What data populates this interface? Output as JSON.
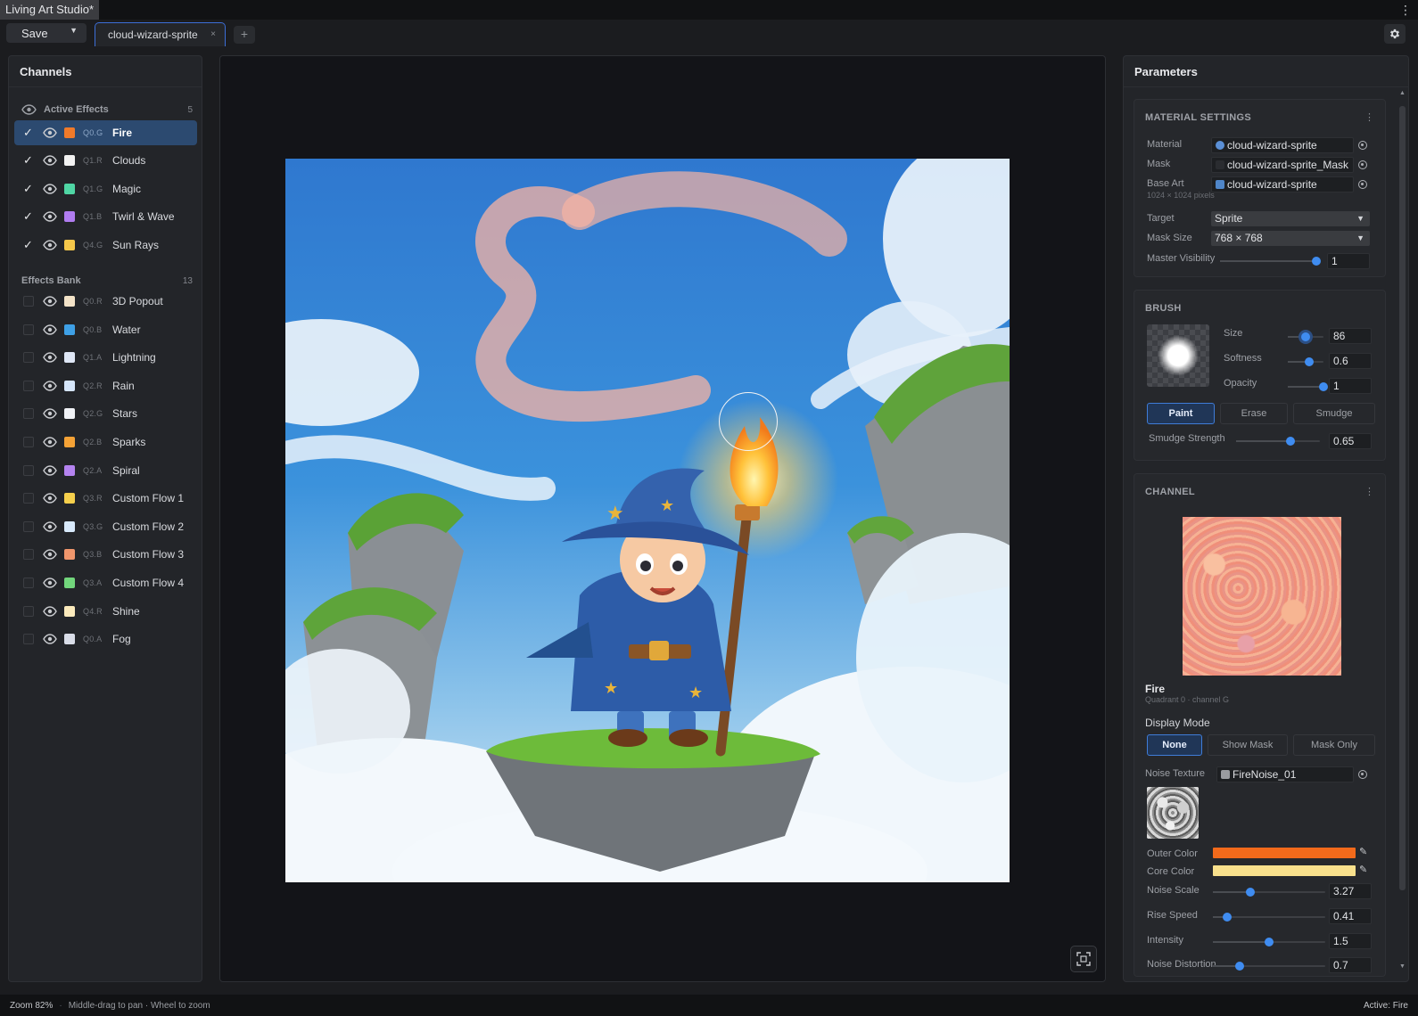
{
  "app": {
    "title": "Living Art Studio*"
  },
  "toolbar": {
    "save_label": "Save",
    "tab_label": "cloud-wizard-sprite",
    "new_tab_label": "+",
    "close_label": "×"
  },
  "channels": {
    "title": "Channels",
    "active_group": {
      "label": "Active Effects",
      "count": "5"
    },
    "bank_group": {
      "label": "Effects Bank",
      "count": "13"
    },
    "active": [
      {
        "code": "Q0.G",
        "name": "Fire",
        "color": "#f07a2a",
        "checked": true,
        "selected": true
      },
      {
        "code": "Q1.R",
        "name": "Clouds",
        "color": "#f2f2f2",
        "checked": true
      },
      {
        "code": "Q1.G",
        "name": "Magic",
        "color": "#4fd6a4",
        "checked": true
      },
      {
        "code": "Q1.B",
        "name": "Twirl & Wave",
        "color": "#b07cf0",
        "checked": true
      },
      {
        "code": "Q4.G",
        "name": "Sun Rays",
        "color": "#f6c84a",
        "checked": true
      }
    ],
    "bank": [
      {
        "code": "Q0.R",
        "name": "3D Popout",
        "color": "#f3e3c8"
      },
      {
        "code": "Q0.B",
        "name": "Water",
        "color": "#3ea0e6"
      },
      {
        "code": "Q1.A",
        "name": "Lightning",
        "color": "#dfe7f6"
      },
      {
        "code": "Q2.R",
        "name": "Rain",
        "color": "#d6e6fb"
      },
      {
        "code": "Q2.G",
        "name": "Stars",
        "color": "#f0f2f6"
      },
      {
        "code": "Q2.B",
        "name": "Sparks",
        "color": "#f5a236"
      },
      {
        "code": "Q2.A",
        "name": "Spiral",
        "color": "#b483f0"
      },
      {
        "code": "Q3.R",
        "name": "Custom Flow 1",
        "color": "#f6d04c"
      },
      {
        "code": "Q3.G",
        "name": "Custom Flow 2",
        "color": "#d8e9fb"
      },
      {
        "code": "Q3.B",
        "name": "Custom Flow 3",
        "color": "#f0966c"
      },
      {
        "code": "Q3.A",
        "name": "Custom Flow 4",
        "color": "#72d67c"
      },
      {
        "code": "Q4.R",
        "name": "Shine",
        "color": "#fbeabc"
      },
      {
        "code": "Q0.A",
        "name": "Fog",
        "color": "#d9dde8"
      }
    ]
  },
  "params": {
    "title": "Parameters",
    "material": {
      "title": "MATERIAL SETTINGS",
      "material_label": "Material",
      "material_value": "cloud-wizard-sprite",
      "mask_label": "Mask",
      "mask_value": "cloud-wizard-sprite_Mask",
      "base_label": "Base Art",
      "base_value": "cloud-wizard-sprite",
      "base_dims": "1024 × 1024 pixels",
      "target_label": "Target",
      "target_value": "Sprite",
      "mask_size_label": "Mask Size",
      "mask_size_value": "768 × 768",
      "visibility_label": "Master Visibility",
      "visibility_value": "1"
    },
    "brush": {
      "title": "BRUSH",
      "size_label": "Size",
      "size_value": "86",
      "softness_label": "Softness",
      "softness_value": "0.6",
      "opacity_label": "Opacity",
      "opacity_value": "1",
      "modes": [
        "Paint",
        "Erase",
        "Smudge"
      ],
      "active_mode": "Paint",
      "smudge_label": "Smudge Strength",
      "smudge_value": "0.65"
    },
    "channel": {
      "title": "CHANNEL",
      "name": "Fire",
      "subtitle": "Quadrant 0 · channel G",
      "display_mode_label": "Display Mode",
      "display_modes": [
        "None",
        "Show Mask",
        "Mask Only"
      ],
      "active_display": "None",
      "noise_texture_label": "Noise Texture",
      "noise_texture_value": "FireNoise_01",
      "outer_color_label": "Outer Color",
      "outer_color": "#f26a1b",
      "core_color_label": "Core Color",
      "core_color": "#f8e08c",
      "noise_scale_label": "Noise Scale",
      "noise_scale_value": "3.27",
      "rise_speed_label": "Rise Speed",
      "rise_speed_value": "0.41",
      "intensity_label": "Intensity",
      "intensity_value": "1.5",
      "noise_distortion_label": "Noise Distortion",
      "noise_distortion_value": "0.7"
    }
  },
  "status": {
    "zoom": "Zoom 82%",
    "hint": "Middle-drag to pan · Wheel to zoom",
    "active": "Active: Fire"
  },
  "accent": "#3f8cf0"
}
